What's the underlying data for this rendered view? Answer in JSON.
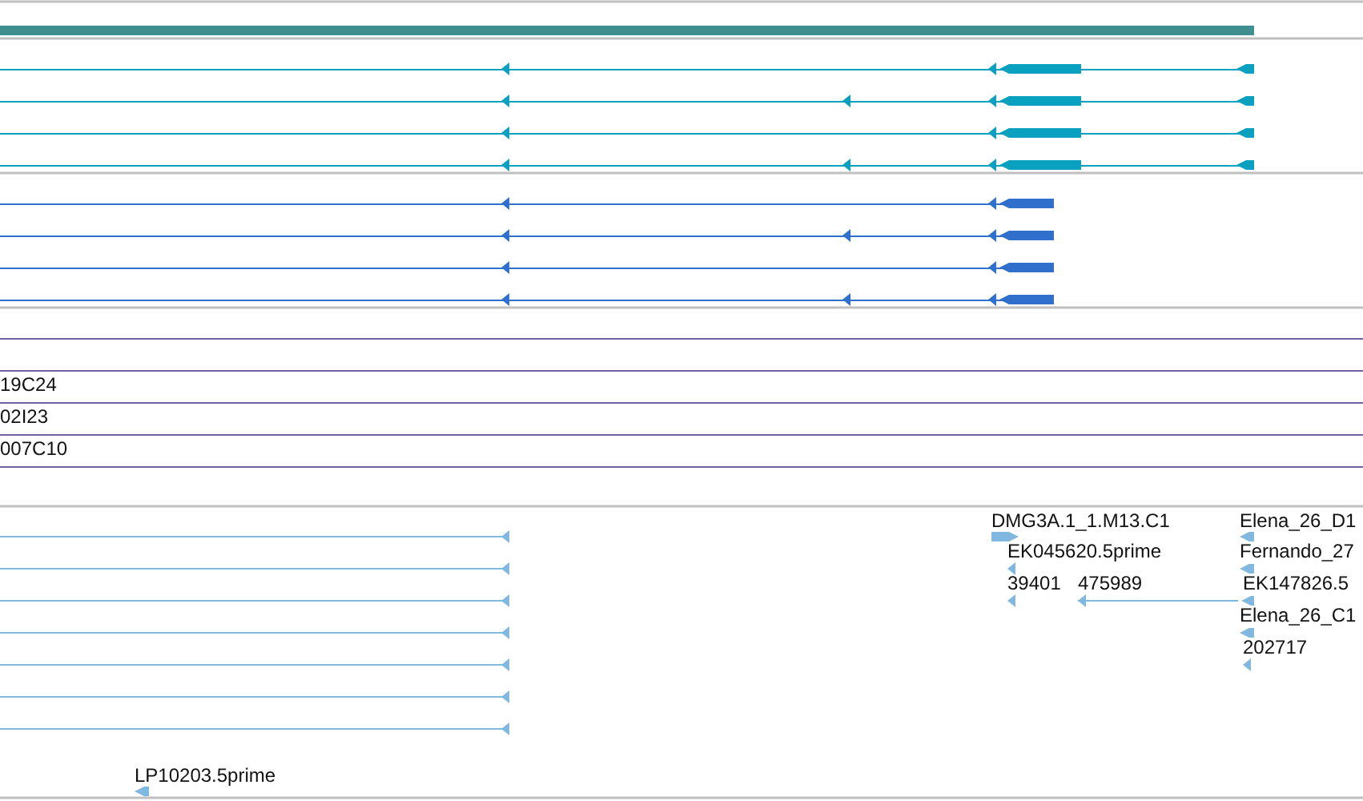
{
  "tracks": [
    {
      "kind": "contig",
      "color": "#3f8f91"
    },
    {
      "kind": "transcripts",
      "color": "#0aa0c0",
      "rows": [
        {
          "extra_intron": false
        },
        {
          "extra_intron": true
        },
        {
          "extra_intron": false
        },
        {
          "extra_intron": true
        }
      ]
    },
    {
      "kind": "cds",
      "color": "#3070cc",
      "rows": [
        {
          "extra_intron": false
        },
        {
          "extra_intron": true
        },
        {
          "extra_intron": false
        },
        {
          "extra_intron": true
        }
      ]
    },
    {
      "kind": "clones",
      "color": "#7060a0",
      "rows": [
        {
          "label": null
        },
        {
          "label": null
        },
        {
          "label": "19C24"
        },
        {
          "label": "02I23"
        },
        {
          "label": "007C10"
        }
      ]
    },
    {
      "kind": "ests",
      "color": "#80b8e0",
      "lines": [
        {
          "reverse": true
        },
        {
          "reverse": true
        },
        {
          "reverse": true
        },
        {
          "reverse": true
        },
        {
          "reverse": true
        },
        {
          "reverse": true
        },
        {
          "reverse": true
        }
      ],
      "features": [
        {
          "label": "LP10203.5prime",
          "reverse": true
        },
        {
          "label": "DMG3A.1_1.M13.C1",
          "reverse": false
        },
        {
          "label": "EK045620.5prime",
          "reverse": true
        },
        {
          "label": "39401",
          "reverse": true
        },
        {
          "label": "475989",
          "reverse": true
        },
        {
          "label": "Elena_26_D1",
          "reverse": true
        },
        {
          "label": "Fernando_27",
          "reverse": true
        },
        {
          "label": "EK147826.5",
          "reverse": true
        },
        {
          "label": "Elena_26_C1",
          "reverse": true
        },
        {
          "label": "202717",
          "reverse": true
        }
      ]
    }
  ]
}
